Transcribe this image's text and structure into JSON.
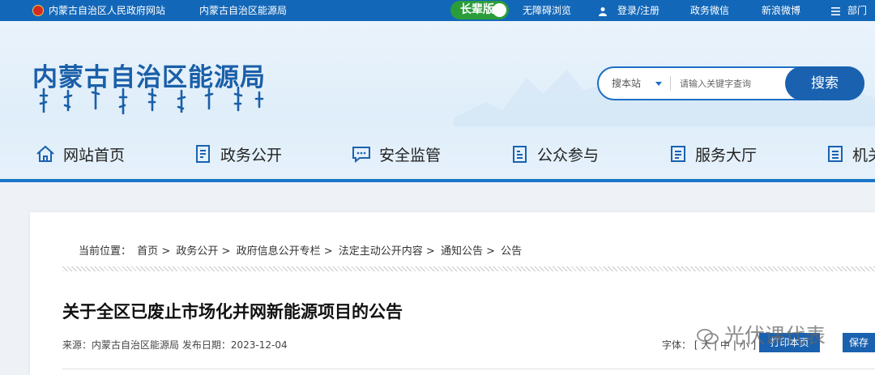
{
  "topbar": {
    "gov_site": "内蒙古自治区人民政府网站",
    "bureau_site": "内蒙古自治区能源局",
    "elder_mode": "长辈版",
    "accessible": "无障碍浏览",
    "login": "登录/注册",
    "wechat": "政务微信",
    "weibo": "新浪微博",
    "dept": "部门"
  },
  "header": {
    "site_title": "内蒙古自治区能源局"
  },
  "search": {
    "scope": "搜本站",
    "placeholder": "请输入关键字查询",
    "button": "搜索"
  },
  "nav": {
    "items": [
      {
        "label": "网站首页",
        "icon": "home-icon"
      },
      {
        "label": "政务公开",
        "icon": "document-icon"
      },
      {
        "label": "安全监管",
        "icon": "chat-icon"
      },
      {
        "label": "公众参与",
        "icon": "clipboard-icon"
      },
      {
        "label": "服务大厅",
        "icon": "service-icon"
      },
      {
        "label": "机关",
        "icon": "building-icon"
      }
    ]
  },
  "breadcrumb": {
    "label": "当前位置：",
    "items": [
      "首页",
      "政务公开",
      "政府信息公开专栏",
      "法定主动公开内容",
      "通知公告",
      "公告"
    ],
    "separator": ">"
  },
  "article": {
    "title": "关于全区已废止市场化并网新能源项目的公告",
    "source_label": "来源：",
    "source": "内蒙古自治区能源局",
    "date_label": "发布日期：",
    "date": "2023-12-04",
    "font_label": "字体：",
    "font_bracket": "[ 大 | 中 | 小 ]",
    "print": "打印本页",
    "save": "保存"
  },
  "watermark": "光伏课代表",
  "colors": {
    "topbar": "#1367b8",
    "accent": "#1a62b0",
    "title": "#1a5fa8",
    "elder": "#2a9d3a"
  }
}
